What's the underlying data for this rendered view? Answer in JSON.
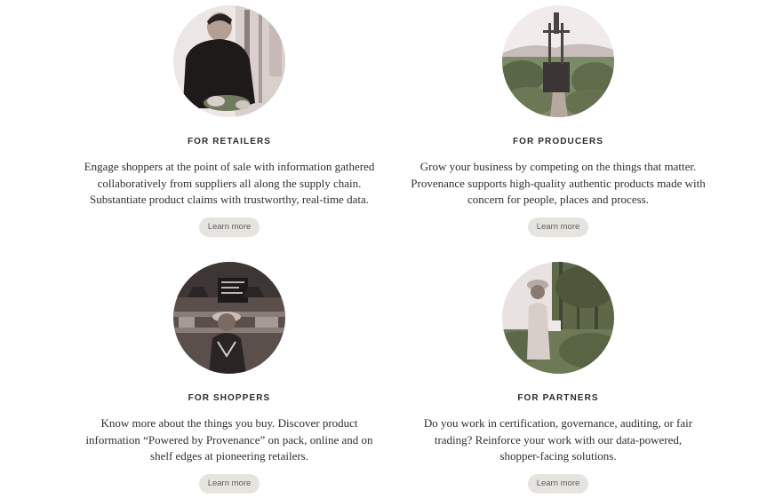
{
  "cards": [
    {
      "heading": "FOR RETAILERS",
      "lines": [
        "Engage shoppers at the point of sale with information gathered",
        "collaboratively from suppliers all along the supply chain.",
        "Substantiate product claims with trustworthy, real-time data."
      ],
      "button": "Learn more",
      "photo_icon": "shopkeeper-photo"
    },
    {
      "heading": "FOR PRODUCERS",
      "lines": [
        "Grow your business by competing on the things that matter.",
        "Provenance supports high-quality authentic products made with",
        "concern for people, places and process."
      ],
      "button": "Learn more",
      "photo_icon": "farm-tractor-photo"
    },
    {
      "heading": "FOR SHOPPERS",
      "lines": [
        "Know more about the things you buy. Discover product",
        "information “Powered by Provenance” on pack, online and on",
        "shelf edges at pioneering retailers."
      ],
      "button": "Learn more",
      "photo_icon": "shopper-in-store-photo"
    },
    {
      "heading": "FOR PARTNERS",
      "lines": [
        "Do you work in certification, governance, auditing, or fair",
        "trading? Reinforce your work with our data-powered,",
        "shopper-facing solutions."
      ],
      "button": "Learn more",
      "photo_icon": "tea-picker-photo"
    }
  ],
  "colors": {
    "button_bg": "#e6e4df",
    "button_text": "#5e5e5e",
    "heading_text": "#2b2b2b",
    "body_text": "#2f2f2f"
  }
}
